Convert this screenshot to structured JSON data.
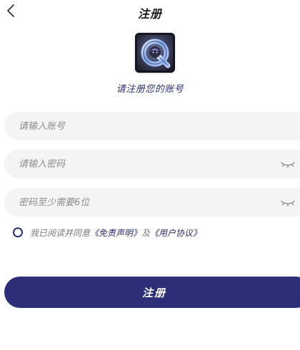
{
  "header": {
    "title": "注册",
    "back_icon": "chevron-left-icon"
  },
  "logo": {
    "alt": "Q"
  },
  "subtitle": "请注册您的账号",
  "fields": {
    "account_placeholder": "请输入账号",
    "password_placeholder": "请输入密码",
    "confirm_placeholder": "密码至少需要6位",
    "eye_icon": "eye-closed-icon"
  },
  "agreement": {
    "prefix": "我已阅读并同意",
    "disclaimer": "《免责声明》",
    "and": "及",
    "user_agreement": "《用户协议》"
  },
  "actions": {
    "register_label": "注册"
  },
  "colors": {
    "brand": "#2c2e77",
    "field_bg": "#f4f4f4",
    "muted_text": "#8c8c8c"
  }
}
